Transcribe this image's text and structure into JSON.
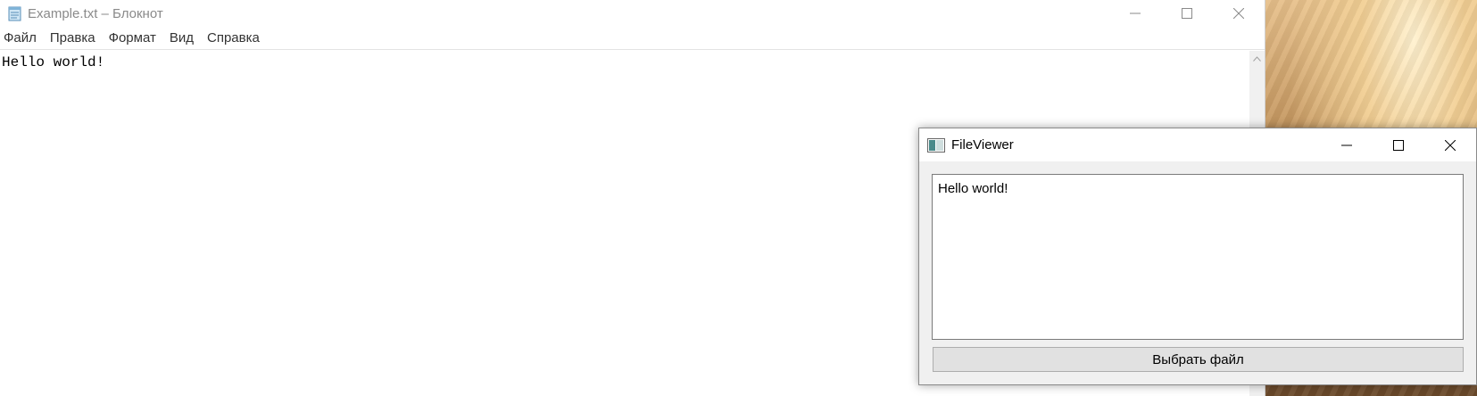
{
  "notepad": {
    "title": "Example.txt – Блокнот",
    "menu": [
      "Файл",
      "Правка",
      "Формат",
      "Вид",
      "Справка"
    ],
    "content": "Hello world!",
    "icons": {
      "app": "notepad-icon",
      "minimize": "minimize-icon",
      "maximize": "maximize-icon",
      "close": "close-icon",
      "scroll_up": "scroll-up-arrow-icon"
    }
  },
  "fileviewer": {
    "title": "FileViewer",
    "content": "Hello world!",
    "select_button": "Выбрать файл",
    "icons": {
      "app": "window-app-icon",
      "minimize": "minimize-icon",
      "maximize": "maximize-icon",
      "close": "close-icon"
    }
  },
  "colors": {
    "notepad_title_text": "#8a8a8a",
    "button_bg": "#e1e1e1",
    "window_bg": "#f0f0f0"
  }
}
